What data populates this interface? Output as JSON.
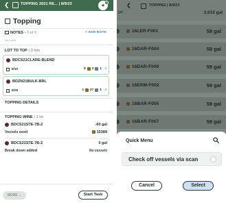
{
  "left": {
    "header": {
      "back_glyph": "❮",
      "breadcrumb": "TOPPING 2021 RE... | 8/9/23",
      "bell_badge": "1"
    },
    "title": "Topping",
    "notes": {
      "label": "NOTES",
      "count": "• 0 of 0",
      "add_label": "+ ADD NOTE",
      "empty_text": "No notes"
    },
    "lot_to_top": {
      "label": "LOT TO TOP",
      "count": "/ 2 lots",
      "items": [
        {
          "name": "BDCS21CLARE-BLEND",
          "date": "8/10",
          "stats": "9",
          "stats2": "3",
          "stats3": "1"
        },
        {
          "name": "BDZN21BULK-BRL",
          "date": "8/29",
          "stats": "1",
          "stats2": "27",
          "stats3": "1"
        }
      ]
    },
    "topping_details": {
      "label": "TOPPING DETAILS"
    },
    "topping_wine": {
      "label": "TOPPING WINE",
      "count": "/ 1 lot",
      "item1_name": "BDCS21STE-7B-2",
      "item1_amount": "-60 gal",
      "vessels_label": "Vessels used",
      "vessels_value": "15389",
      "item2_name": "BDCS21STE-7B-2",
      "item2_amount": "0 gal",
      "breakdown_label": "Break down added",
      "breakdown_value": "No vessels"
    },
    "bottom": {
      "more_label": "MORE",
      "start_label": "Start Task"
    }
  },
  "right": {
    "header": {
      "back_glyph": "❮",
      "breadcrumb": "TOPPING | 8/9/23",
      "gal_label": "gal",
      "total": "3,615 gal"
    },
    "vessels": [
      {
        "name": "16LER-F001",
        "gal": "59 gal"
      },
      {
        "name": "16DAR-F004",
        "gal": "59 gal"
      },
      {
        "name": "16DAR-F009",
        "gal": "59 gal"
      },
      {
        "name": "16ERM-F002",
        "gal": "59 gal"
      },
      {
        "name": "16BAR-F005",
        "gal": "59 gal"
      },
      {
        "name": "16BAR-F007",
        "gal": "59 gal"
      }
    ],
    "quick_menu": {
      "title": "Quick Menu",
      "option": "Check off vessels via scan",
      "cancel_label": "Cancel",
      "select_label": "Select"
    }
  },
  "colors": {
    "header_green": "#3f6a4c",
    "wine_dot": "#5a2a37",
    "link_blue": "#3b7fc7",
    "select_blue": "#cfe0f5",
    "overlay_gray": "#7e8882"
  }
}
